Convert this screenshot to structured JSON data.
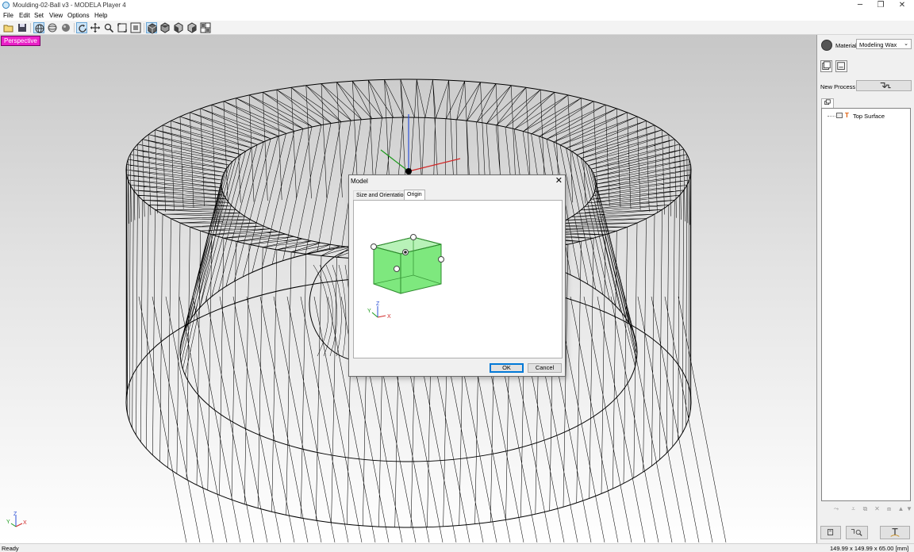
{
  "window": {
    "title": "Moulding-02-Ball v3 - MODELA Player 4",
    "controls": [
      "minimize",
      "restore",
      "close"
    ]
  },
  "menu": [
    "File",
    "Edit",
    "Set",
    "View",
    "Options",
    "Help"
  ],
  "toolbar": {
    "buttons": [
      {
        "name": "open-icon",
        "active": false
      },
      {
        "name": "save-icon",
        "active": false
      },
      {
        "name": "wireframe-icon",
        "active": true
      },
      {
        "name": "sphere-wire-icon",
        "active": false
      },
      {
        "name": "sphere-solid-icon",
        "active": false
      },
      {
        "name": "rotate-icon",
        "active": true
      },
      {
        "name": "pan-icon",
        "active": false
      },
      {
        "name": "zoom-icon",
        "active": false
      },
      {
        "name": "zoom-window-icon",
        "active": false
      },
      {
        "name": "fit-icon",
        "active": false
      },
      {
        "name": "view-iso-icon",
        "active": true
      },
      {
        "name": "view-top-icon",
        "active": false
      },
      {
        "name": "view-front-icon",
        "active": false
      },
      {
        "name": "view-side-icon",
        "active": false
      },
      {
        "name": "view-multi-icon",
        "active": false
      }
    ]
  },
  "viewport": {
    "mode_label": "Perspective",
    "mode_color": "#ea21c8",
    "axes": {
      "x": "X",
      "y": "Y",
      "z": "Z"
    }
  },
  "panel": {
    "material_label": "Material",
    "material_value": "Modeling Wax",
    "new_process_label": "New Process",
    "tree": [
      {
        "label": "Top Surface",
        "icon": "top-surface-icon"
      }
    ]
  },
  "dialog": {
    "title": "Model",
    "tabs": [
      {
        "label": "Size and Orientation",
        "selected": false
      },
      {
        "label": "Origin",
        "selected": true
      }
    ],
    "axes": {
      "x": "X",
      "y": "Y",
      "z": "Z"
    },
    "ok_label": "OK",
    "cancel_label": "Cancel",
    "cube_color": "#7ee87e"
  },
  "status": {
    "left": "Ready",
    "right": "149.99 x 149.99 x 65.00 [mm]"
  }
}
